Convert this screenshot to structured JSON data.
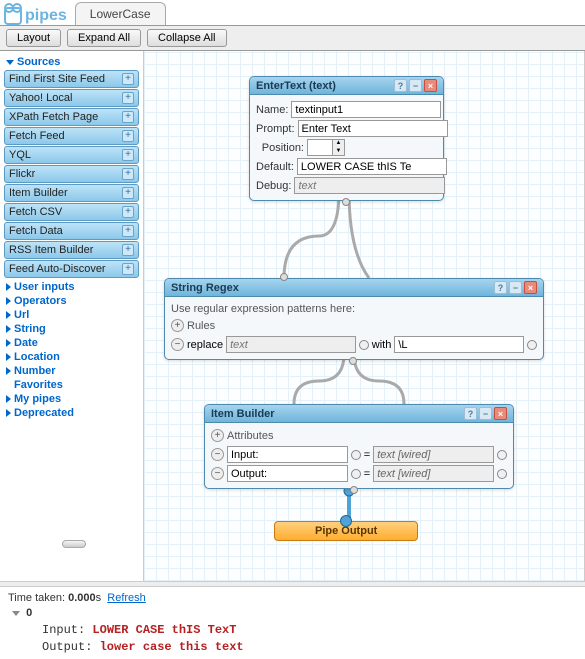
{
  "app": {
    "logo_text": "pipes",
    "tab_title": "LowerCase"
  },
  "toolbar": {
    "layout": "Layout",
    "expand": "Expand All",
    "collapse": "Collapse All"
  },
  "sidebar": {
    "sources_label": "Sources",
    "sources": [
      "Find First Site Feed",
      "Yahoo! Local",
      "XPath Fetch Page",
      "Fetch Feed",
      "YQL",
      "Flickr",
      "Item Builder",
      "Fetch CSV",
      "Fetch Data",
      "RSS Item Builder",
      "Feed Auto-Discover"
    ],
    "sections": [
      "User inputs",
      "Operators",
      "Url",
      "String",
      "Date",
      "Location",
      "Number",
      "Favorites",
      "My pipes",
      "Deprecated"
    ]
  },
  "modules": {
    "entertext": {
      "title": "EnterText (text)",
      "name_label": "Name:",
      "name_val": "textinput1",
      "prompt_label": "Prompt:",
      "prompt_val": "Enter Text",
      "position_label": "Position:",
      "default_label": "Default:",
      "default_val": "LOWER CASE thIS Te",
      "debug_label": "Debug:",
      "debug_placeholder": "text"
    },
    "regex": {
      "title": "String Regex",
      "desc": "Use regular expression patterns here:",
      "rules_label": "Rules",
      "replace_label": "replace",
      "replace_placeholder": "text",
      "with_label": "with",
      "with_val": "\\L"
    },
    "itembuilder": {
      "title": "Item Builder",
      "attr_label": "Attributes",
      "row1_key": "Input:",
      "row1_val": "text [wired]",
      "row2_key": "Output:",
      "row2_val": "text [wired]"
    },
    "pipeout": "Pipe Output"
  },
  "output": {
    "timetaken_label": "Time taken: ",
    "timetaken_val": "0.000",
    "seconds": "s",
    "refresh": "Refresh",
    "count": "0",
    "input_label": "Input: ",
    "input_val": "LOWER CASE thIS TexT",
    "output_label": "Output: ",
    "output_val": "lower case this text"
  }
}
